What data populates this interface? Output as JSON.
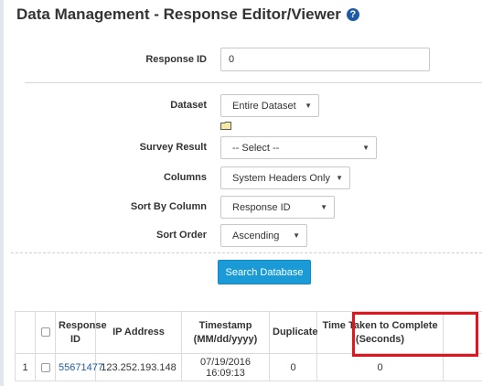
{
  "page": {
    "title": "Data Management - Response Editor/Viewer",
    "help_icon": "question-circle-icon"
  },
  "form": {
    "response_id": {
      "label": "Response ID",
      "value": "0"
    },
    "dataset": {
      "label": "Dataset",
      "value": "Entire Dataset",
      "folder_icon": "folder-icon"
    },
    "survey_result": {
      "label": "Survey Result",
      "value": "-- Select --"
    },
    "columns": {
      "label": "Columns",
      "value": "System Headers Only"
    },
    "sort_by_column": {
      "label": "Sort By Column",
      "value": "Response ID"
    },
    "sort_order": {
      "label": "Sort Order",
      "value": "Ascending"
    },
    "search_button": "Search Database"
  },
  "table": {
    "headers": {
      "index": "",
      "select": "",
      "response_id": "Response ID",
      "ip_address": "IP Address",
      "timestamp": "Timestamp (MM/dd/yyyy)",
      "duplicate": "Duplicate",
      "time_taken": "Time Taken to Complete (Seconds)"
    },
    "rows": [
      {
        "index": "1",
        "response_id": "55671477",
        "ip_address": "123.252.193.148",
        "timestamp": "07/19/2016 16:09:13",
        "duplicate": "0",
        "time_taken": "0"
      }
    ]
  },
  "colors": {
    "accent": "#1a9bd7",
    "link": "#1f5aa6",
    "highlight": "#e3141e"
  }
}
